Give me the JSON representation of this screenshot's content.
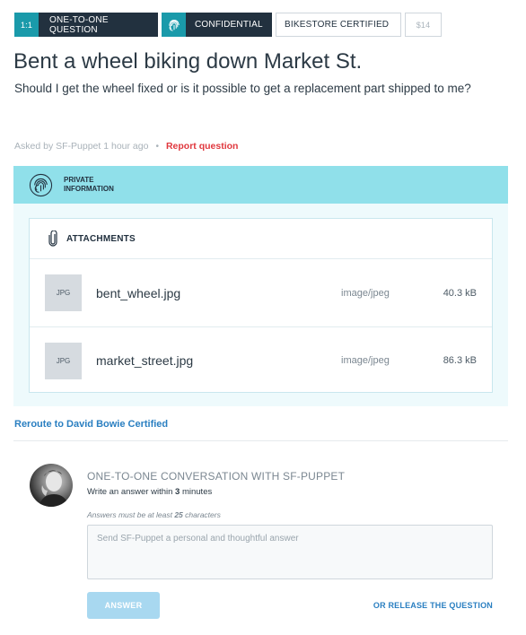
{
  "tags": {
    "one_to_one_short": "1:1",
    "one_to_one": "ONE-TO-ONE QUESTION",
    "confidential": "CONFIDENTIAL",
    "certified": "BIKESTORE CERTIFIED",
    "price": "$14"
  },
  "question": {
    "title": "Bent a wheel biking down Market St.",
    "body": "Should I get the wheel fixed or is it possible to get a replacement part shipped to me?",
    "asked_by": "Asked by SF-Puppet 1 hour ago",
    "dot": "•",
    "report_label": "Report question"
  },
  "private": {
    "label_line1": "PRIVATE",
    "label_line2": "INFORMATION",
    "attachments_label": "ATTACHMENTS",
    "files": [
      {
        "thumb": "JPG",
        "name": "bent_wheel.jpg",
        "type": "image/jpeg",
        "size": "40.3 kB"
      },
      {
        "thumb": "JPG",
        "name": "market_street.jpg",
        "type": "image/jpeg",
        "size": "86.3 kB"
      }
    ]
  },
  "reroute_label": "Reroute to David Bowie Certified",
  "conversation": {
    "title": "ONE-TO-ONE CONVERSATION WITH SF-PUPPET",
    "sub_prefix": "Write an answer within ",
    "sub_bold": "3",
    "sub_suffix": " minutes",
    "min_prefix": "Answers must be at least ",
    "min_bold": "25",
    "min_suffix": " characters",
    "placeholder": "Send SF-Puppet a personal and thoughtful answer",
    "answer_button": "ANSWER",
    "release_link": "OR RELEASE THE QUESTION"
  },
  "colors": {
    "teal": "#1a9aaa",
    "dark": "#22313f",
    "private_bg": "#90e0ea",
    "link": "#2a7fc1",
    "report": "#e0383e"
  },
  "icons": [
    "fingerprint-icon",
    "paperclip-icon"
  ]
}
